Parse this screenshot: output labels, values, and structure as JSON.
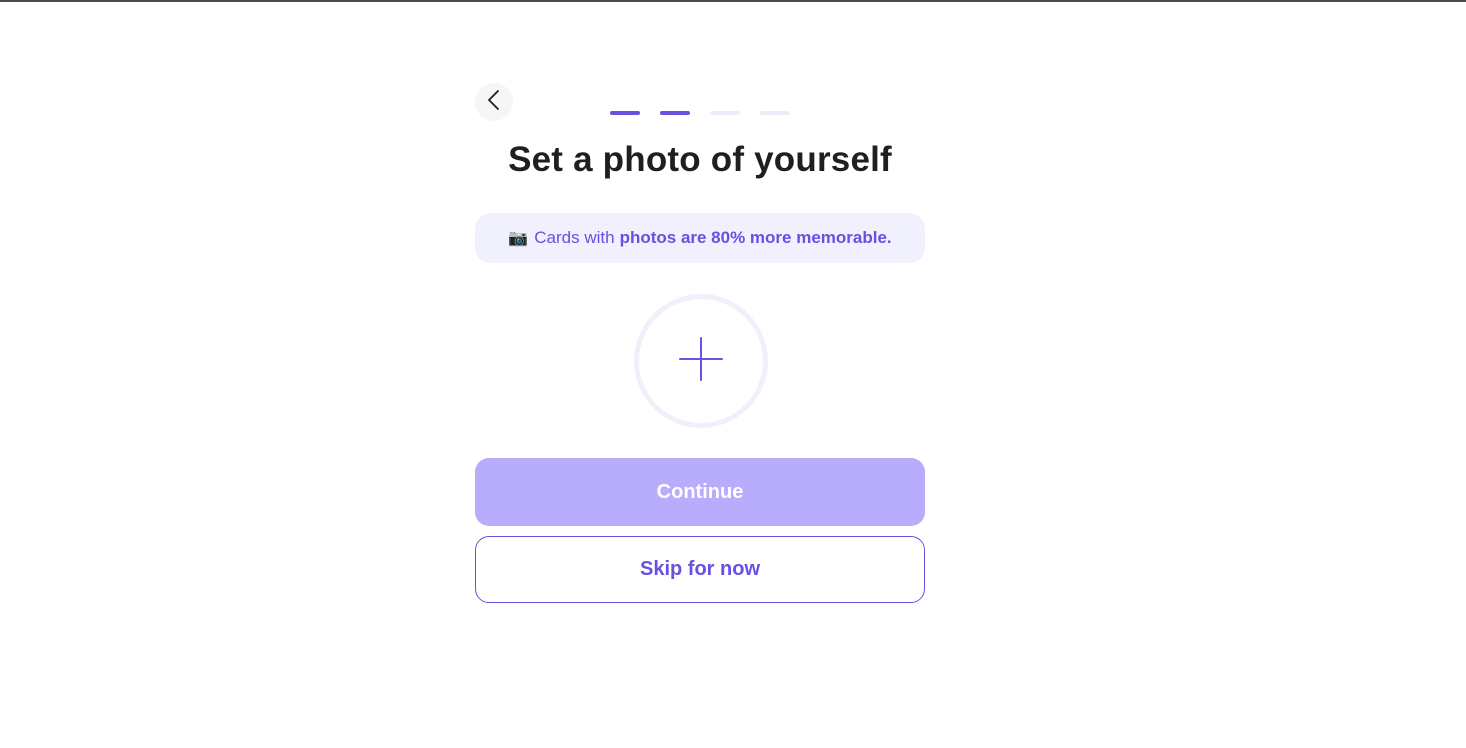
{
  "header": {
    "back_icon": "chevron-left-icon",
    "progress": {
      "total_steps": 4,
      "current_step": 2
    }
  },
  "title": "Set a photo of yourself",
  "tip": {
    "icon": "camera-icon",
    "emoji": "📷",
    "text_plain": "Cards with",
    "text_bold": "photos are 80% more memorable."
  },
  "avatar_upload": {
    "icon": "plus-icon"
  },
  "buttons": {
    "continue_label": "Continue",
    "skip_label": "Skip for now"
  },
  "colors": {
    "accent": "#6a4fe0",
    "accent_light": "#b8acfc",
    "tip_bg": "#f1f0fd",
    "progress_inactive": "#eeecfa",
    "title": "#1f1f1f"
  }
}
